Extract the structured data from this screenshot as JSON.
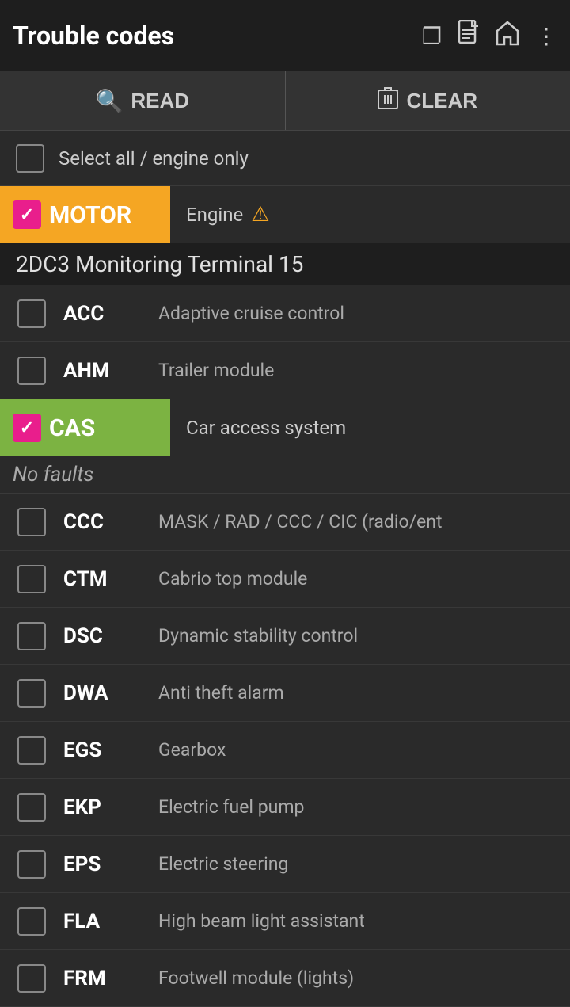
{
  "header": {
    "title": "Trouble codes",
    "icons": [
      "copy-icon",
      "document-icon",
      "home-icon",
      "more-icon"
    ]
  },
  "toolbar": {
    "read_label": "READ",
    "clear_label": "CLEAR"
  },
  "select_all": {
    "label": "Select all / engine only",
    "checked": false
  },
  "groups": [
    {
      "id": "motor",
      "badge": "MOTOR",
      "badge_color": "orange",
      "description": "Engine",
      "has_warning": true,
      "subgroup": "2DC3 Monitoring Terminal 15",
      "checked": true,
      "items": [
        {
          "code": "ACC",
          "description": "Adaptive cruise control",
          "checked": false
        },
        {
          "code": "AHM",
          "description": "Trailer module",
          "checked": false
        },
        {
          "code": "CAS",
          "description": "Car access system",
          "checked": true,
          "badge_color": "green",
          "no_faults": "No faults"
        },
        {
          "code": "CCC",
          "description": "MASK / RAD / CCC / CIC (radio/ent",
          "checked": false
        },
        {
          "code": "CTM",
          "description": "Cabrio top module",
          "checked": false
        },
        {
          "code": "DSC",
          "description": "Dynamic stability control",
          "checked": false
        },
        {
          "code": "DWA",
          "description": "Anti theft alarm",
          "checked": false
        },
        {
          "code": "EGS",
          "description": "Gearbox",
          "checked": false
        },
        {
          "code": "EKP",
          "description": "Electric fuel pump",
          "checked": false
        },
        {
          "code": "EPS",
          "description": "Electric steering",
          "checked": false
        },
        {
          "code": "FLA",
          "description": "High beam light assistant",
          "checked": false
        },
        {
          "code": "FRM",
          "description": "Footwell module (lights)",
          "checked": false
        }
      ]
    }
  ]
}
